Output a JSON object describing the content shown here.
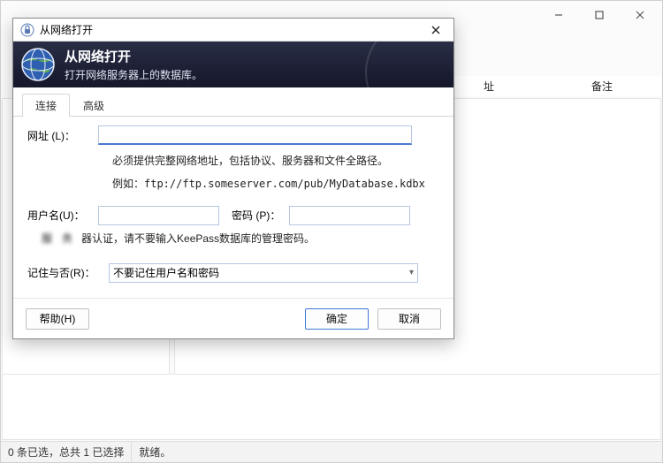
{
  "main_window": {
    "col_headers": {
      "addr": "址",
      "note": "备注"
    }
  },
  "statusbar": {
    "sel": "0 条已选，总共 1 已选择",
    "ready": "就绪。"
  },
  "dialog": {
    "title": "从网络打开",
    "banner": {
      "heading": "从网络打开",
      "sub": "打开网络服务器上的数据库。"
    },
    "tabs": {
      "connect": "连接",
      "advanced": "高级"
    },
    "form": {
      "url_label": "网址 (L)：",
      "url_value": "",
      "url_hint": "必须提供完整网络地址，包括协议、服务器和文件全路径。",
      "url_example": "例如：ftp://ftp.someserver.com/pub/MyDatabase.kdbx",
      "user_label": "用户名(U)：",
      "user_value": "",
      "pass_label": "密码 (P)：",
      "pass_value": "",
      "server_blur": "服 务",
      "server_auth_note": "器认证，请不要输入KeePass数据库的管理密码。",
      "remember_label": "记住与否(R)：",
      "remember_value": "不要记住用户名和密码"
    },
    "buttons": {
      "help": "帮助(H)",
      "ok": "确定",
      "cancel": "取消"
    }
  }
}
